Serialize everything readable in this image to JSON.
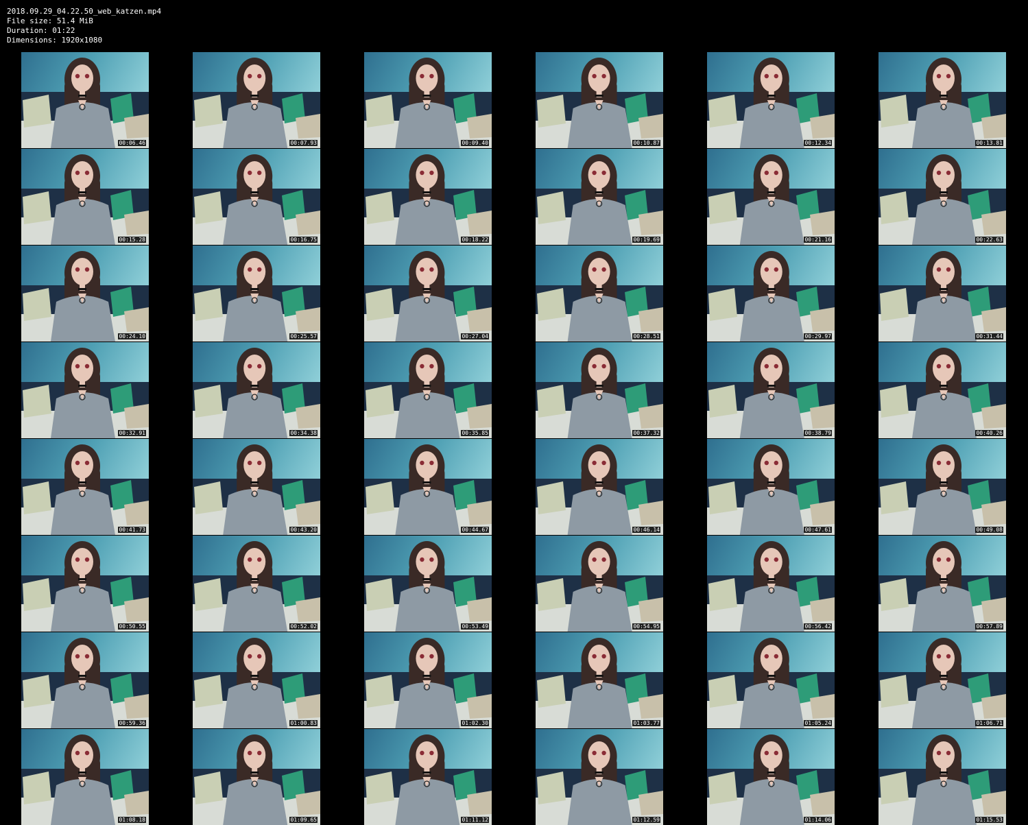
{
  "info": {
    "filename": "2018.09.29_04.22.50_web_katzen.mp4",
    "file_size": "File size: 51.4 MiB",
    "duration": "Duration: 01:22",
    "dimensions": "Dimensions: 1920x1080"
  },
  "colors": {
    "background": "#000000",
    "text": "#ffffff",
    "wall_teal": "#4fa0b4",
    "sofa_navy": "#1e3046",
    "pillow_green": "#2e9c78",
    "shirt_gray": "#8e9aa4",
    "hair_brown": "#3a2a26"
  },
  "thumbnails": [
    {
      "time": "00:06.46"
    },
    {
      "time": "00:07.93"
    },
    {
      "time": "00:09.40"
    },
    {
      "time": "00:10.87"
    },
    {
      "time": "00:12.34"
    },
    {
      "time": "00:13.81"
    },
    {
      "time": "00:15.28"
    },
    {
      "time": "00:16.75"
    },
    {
      "time": "00:18.22"
    },
    {
      "time": "00:19.69"
    },
    {
      "time": "00:21.16"
    },
    {
      "time": "00:22.63"
    },
    {
      "time": "00:24.10"
    },
    {
      "time": "00:25.57"
    },
    {
      "time": "00:27.04"
    },
    {
      "time": "00:28.51"
    },
    {
      "time": "00:29.97"
    },
    {
      "time": "00:31.44"
    },
    {
      "time": "00:32.91"
    },
    {
      "time": "00:34.38"
    },
    {
      "time": "00:35.85"
    },
    {
      "time": "00:37.32"
    },
    {
      "time": "00:38.79"
    },
    {
      "time": "00:40.26"
    },
    {
      "time": "00:41.73"
    },
    {
      "time": "00:43.20"
    },
    {
      "time": "00:44.67"
    },
    {
      "time": "00:46.14"
    },
    {
      "time": "00:47.61"
    },
    {
      "time": "00:49.08"
    },
    {
      "time": "00:50.55"
    },
    {
      "time": "00:52.02"
    },
    {
      "time": "00:53.49"
    },
    {
      "time": "00:54.95"
    },
    {
      "time": "00:56.42"
    },
    {
      "time": "00:57.89"
    },
    {
      "time": "00:59.36"
    },
    {
      "time": "01:00.83"
    },
    {
      "time": "01:02.30"
    },
    {
      "time": "01:03.77"
    },
    {
      "time": "01:05.24"
    },
    {
      "time": "01:06.71"
    },
    {
      "time": "01:08.18"
    },
    {
      "time": "01:09.65"
    },
    {
      "time": "01:11.12"
    },
    {
      "time": "01:12.59"
    },
    {
      "time": "01:14.06"
    },
    {
      "time": "01:15.53"
    }
  ]
}
